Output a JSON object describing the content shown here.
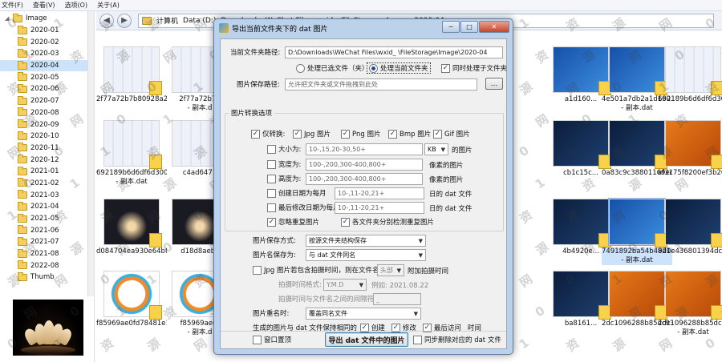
{
  "menu": [
    "文件(F)",
    "查看(V)",
    "选项(O)",
    "关于(A)"
  ],
  "address": [
    "计算机",
    "Data (D:)",
    "Downloads",
    "WeChat Files",
    "wxid_",
    "FileStorage",
    "Image",
    "2020-04"
  ],
  "tree": {
    "root": "Image",
    "items": [
      "2020-01",
      "2020-02",
      "2020-03",
      "2020-04",
      "2020-05",
      "2020-06",
      "2020-07",
      "2020-08",
      "2020-09",
      "2020-10",
      "2020-11",
      "2020-12",
      "2021-01",
      "2021-02",
      "2021-03",
      "2021-04",
      "2021-05",
      "2021-06",
      "2021-07",
      "2021-08",
      "2022-08",
      "Thumb"
    ],
    "selected": "2020-04"
  },
  "files": [
    {
      "line1": "2f77a72b7b80928a2...",
      "line2": ""
    },
    {
      "line1": "2f77a72b7b",
      "line2": "- 副本.d"
    },
    {
      "line1": "a1d160...",
      "line2": ""
    },
    {
      "line1": "4e501a7db2a1d160...",
      "line2": "- 副本.dat"
    },
    {
      "line1": "692189b6d6df6d300...",
      "line2": ""
    },
    {
      "line1": "692189b6d6df6d300...",
      "line2": "- 副本.dat"
    },
    {
      "line1": "c4ad6471",
      "line2": ""
    },
    {
      "line1": "cb1c15c...",
      "line2": ""
    },
    {
      "line1": "0a83c9c38801169ec...",
      "line2": ""
    },
    {
      "line1": "af3175f8200ef3b20c...",
      "line2": ""
    },
    {
      "line1": "d084704ea930e64b8...",
      "line2": ""
    },
    {
      "line1": "d18d8aebc",
      "line2": ""
    },
    {
      "line1": "4b4920e...",
      "line2": ""
    },
    {
      "line1": "7491892ba54b4920e...",
      "line2": "- 副本.dat"
    },
    {
      "line1": "8d1e436801394dc07...",
      "line2": ""
    },
    {
      "line1": "f85969ae0fd78481e1...",
      "line2": ""
    },
    {
      "line1": "f85969ae0f",
      "line2": "- 副本.d"
    },
    {
      "line1": "ba8161...",
      "line2": ""
    },
    {
      "line1": "2dc1096288b85dc93...",
      "line2": ""
    },
    {
      "line1": "2dc1096288b85dc93...",
      "line2": "- 副本.dat"
    }
  ],
  "watermark_chars": [
    "0",
    "1",
    "资",
    "源",
    "网"
  ],
  "dialog": {
    "title": "导出当前文件夹下的 dat 图片",
    "win_buttons": {
      "minimize": "─",
      "maximize": "□",
      "close": "✕"
    },
    "current_folder_label": "当前文件夹路径:",
    "current_folder_value": "D:\\Downloads\\WeChat Files\\wxid_                    \\FileStorage\\Image\\2020-04",
    "radio_selected_files": "处理已选文件（夹）",
    "radio_current_folder": "处理当前文件夹",
    "subfolders_label": "同时处理子文件夹",
    "save_path_label": "图片保存路径:",
    "save_path_placeholder": "允许把文件夹或文件拖拽到此处",
    "browse_label": "...",
    "options_group": "图片转换选项",
    "only_convert_label": "仅转换:",
    "formats": [
      "Jpg 图片",
      "Png 图片",
      "Bmp 图片",
      "Gif 图片"
    ],
    "size_label": "大小为:",
    "size_value": "10-,15,20-30,50+",
    "size_unit": "KB",
    "size_suffix": "的图片",
    "width_label": "宽度为:",
    "width_value": "100-,200,300-400,800+",
    "width_suffix": "像素的图片",
    "height_label": "高度为:",
    "height_value": "100-,200,300-400,800+",
    "height_suffix": "像素的图片",
    "created_label": "创建日期为每月",
    "created_value": "10-,11-20,21+",
    "created_suffix": "日的 dat 文件",
    "modified_label": "最后修改日期为每月",
    "modified_value": "10-,11-20,21+",
    "modified_suffix": "日的 dat 文件",
    "ignore_dup_label": "忽略重复图片",
    "per_folder_dup_label": "各文件夹分别检测重复图片",
    "save_mode_label": "图片保存方式:",
    "save_mode_value": "按源文件夹结构保存",
    "name_as_label": "图片名保存为:",
    "name_as_value": "与 dat 文件同名",
    "capture_time_label": "Jpg 图片若包含拍摄时间，则在文件名",
    "capture_pos_value": "头部",
    "capture_time_suffix": "附加拍摄时间",
    "time_format_label": "拍摄时间格式:",
    "time_format_value": "Y.M.D",
    "time_format_example": "例如: 2021.08.22",
    "separator_label": "拍摄时间与文件名之间的间隔符:",
    "separator_value": "_",
    "rename_label": "图片重名时:",
    "rename_value": "覆盖同名文件",
    "keep_times_label": "生成的图片与 dat 文件保持相同的",
    "keep_created": "创建",
    "keep_modified": "修改",
    "keep_accessed": "最后访问",
    "keep_time_suffix": "时间",
    "topmost_label": "窗口置顶",
    "export_button": "导出 dat 文件中的图片",
    "sync_delete_label": "同步删除对应的 dat 文件",
    "check_mark": "✓"
  }
}
